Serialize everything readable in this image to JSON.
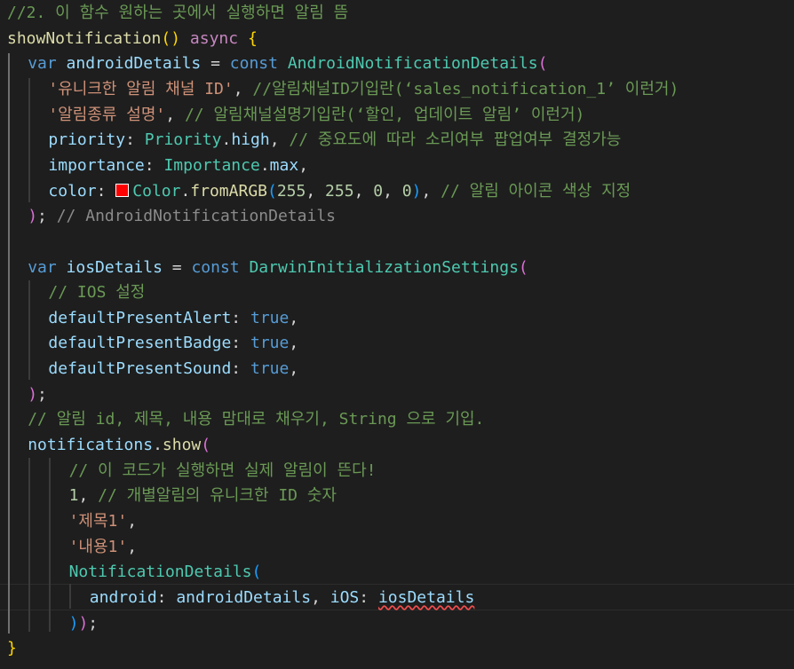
{
  "colors": {
    "background": "#1e1e1e",
    "comment": "#6a9955",
    "keyword": "#569cd6",
    "control": "#c586c0",
    "function": "#dcdcaa",
    "class": "#4ec9b0",
    "variable": "#9cdcfe",
    "string": "#ce9178",
    "number": "#b5cea8",
    "plain": "#d4d4d4",
    "bracket_gold": "#ffd700",
    "bracket_pink": "#da70d6",
    "bracket_blue": "#179fff",
    "color_swatch": "#ff0000",
    "error_squiggle": "#f14c4c"
  },
  "editor": {
    "lines": [
      {
        "indent": 0,
        "tokens": [
          {
            "t": "//2. 이 함수 원하는 곳에서 실행하면 알림 뜸",
            "c": "comment"
          }
        ]
      },
      {
        "indent": 0,
        "tokens": [
          {
            "t": "showNotification",
            "c": "function"
          },
          {
            "t": "() ",
            "c": "bracket_gold"
          },
          {
            "t": "async ",
            "c": "control"
          },
          {
            "t": "{",
            "c": "bracket_gold"
          }
        ]
      },
      {
        "indent": 1,
        "tokens": [
          {
            "t": "var ",
            "c": "keyword"
          },
          {
            "t": "androidDetails",
            "c": "variable"
          },
          {
            "t": " = ",
            "c": "plain"
          },
          {
            "t": "const ",
            "c": "keyword"
          },
          {
            "t": "AndroidNotificationDetails",
            "c": "class"
          },
          {
            "t": "(",
            "c": "bracket_pink"
          }
        ]
      },
      {
        "indent": 2,
        "tokens": [
          {
            "t": "'유니크한 알림 채널 ID'",
            "c": "string"
          },
          {
            "t": ", ",
            "c": "plain"
          },
          {
            "t": "//알림채널ID기입란(‘sales_notification_1’ 이런거)",
            "c": "comment"
          }
        ]
      },
      {
        "indent": 2,
        "tokens": [
          {
            "t": "'알림종류 설명'",
            "c": "string"
          },
          {
            "t": ", ",
            "c": "plain"
          },
          {
            "t": "// 알림채널설명기입란(‘할인, 업데이트 알림’ 이런거)",
            "c": "comment"
          }
        ]
      },
      {
        "indent": 2,
        "tokens": [
          {
            "t": "priority",
            "c": "variable"
          },
          {
            "t": ": ",
            "c": "plain"
          },
          {
            "t": "Priority",
            "c": "class"
          },
          {
            "t": ".",
            "c": "plain"
          },
          {
            "t": "high",
            "c": "variable"
          },
          {
            "t": ", ",
            "c": "plain"
          },
          {
            "t": "// 중요도에 따라 소리여부 팝업여부 결정가능",
            "c": "comment"
          }
        ]
      },
      {
        "indent": 2,
        "tokens": [
          {
            "t": "importance",
            "c": "variable"
          },
          {
            "t": ": ",
            "c": "plain"
          },
          {
            "t": "Importance",
            "c": "class"
          },
          {
            "t": ".",
            "c": "plain"
          },
          {
            "t": "max",
            "c": "variable"
          },
          {
            "t": ",",
            "c": "plain"
          }
        ]
      },
      {
        "indent": 2,
        "tokens": [
          {
            "t": "color",
            "c": "variable"
          },
          {
            "t": ": ",
            "c": "plain"
          },
          {
            "swatch": true
          },
          {
            "t": "Color",
            "c": "class"
          },
          {
            "t": ".",
            "c": "plain"
          },
          {
            "t": "fromARGB",
            "c": "function"
          },
          {
            "t": "(",
            "c": "bracket_blue"
          },
          {
            "t": "255",
            "c": "number"
          },
          {
            "t": ", ",
            "c": "plain"
          },
          {
            "t": "255",
            "c": "number"
          },
          {
            "t": ", ",
            "c": "plain"
          },
          {
            "t": "0",
            "c": "number"
          },
          {
            "t": ", ",
            "c": "plain"
          },
          {
            "t": "0",
            "c": "number"
          },
          {
            "t": ")",
            "c": "bracket_blue"
          },
          {
            "t": ", ",
            "c": "plain"
          },
          {
            "t": "// 알림 아이콘 색상 지정",
            "c": "comment"
          }
        ]
      },
      {
        "indent": 1,
        "tokens": [
          {
            "t": ")",
            "c": "bracket_pink"
          },
          {
            "t": "; ",
            "c": "plain"
          },
          {
            "t": "// AndroidNotificationDetails",
            "c": "comment_dim"
          }
        ]
      },
      {
        "indent": 1,
        "tokens": []
      },
      {
        "indent": 1,
        "tokens": [
          {
            "t": "var ",
            "c": "keyword"
          },
          {
            "t": "iosDetails",
            "c": "variable"
          },
          {
            "t": " = ",
            "c": "plain"
          },
          {
            "t": "const ",
            "c": "keyword"
          },
          {
            "t": "DarwinInitializationSettings",
            "c": "class"
          },
          {
            "t": "(",
            "c": "bracket_pink"
          }
        ]
      },
      {
        "indent": 2,
        "tokens": [
          {
            "t": "// IOS 설정",
            "c": "comment"
          }
        ]
      },
      {
        "indent": 2,
        "tokens": [
          {
            "t": "defaultPresentAlert",
            "c": "variable"
          },
          {
            "t": ": ",
            "c": "plain"
          },
          {
            "t": "true",
            "c": "keyword"
          },
          {
            "t": ",",
            "c": "plain"
          }
        ]
      },
      {
        "indent": 2,
        "tokens": [
          {
            "t": "defaultPresentBadge",
            "c": "variable"
          },
          {
            "t": ": ",
            "c": "plain"
          },
          {
            "t": "true",
            "c": "keyword"
          },
          {
            "t": ",",
            "c": "plain"
          }
        ]
      },
      {
        "indent": 2,
        "tokens": [
          {
            "t": "defaultPresentSound",
            "c": "variable"
          },
          {
            "t": ": ",
            "c": "plain"
          },
          {
            "t": "true",
            "c": "keyword"
          },
          {
            "t": ",",
            "c": "plain"
          }
        ]
      },
      {
        "indent": 1,
        "tokens": [
          {
            "t": ")",
            "c": "bracket_pink"
          },
          {
            "t": ";",
            "c": "plain"
          }
        ]
      },
      {
        "indent": 1,
        "tokens": [
          {
            "t": "// 알림 id, 제목, 내용 맘대로 채우기, String 으로 기입.",
            "c": "comment"
          }
        ]
      },
      {
        "indent": 1,
        "tokens": [
          {
            "t": "notifications",
            "c": "variable"
          },
          {
            "t": ".",
            "c": "plain"
          },
          {
            "t": "show",
            "c": "function"
          },
          {
            "t": "(",
            "c": "bracket_pink"
          }
        ]
      },
      {
        "indent": 3,
        "tokens": [
          {
            "t": "// 이 코드가 실행하면 실제 알림이 뜬다!",
            "c": "comment"
          }
        ]
      },
      {
        "indent": 3,
        "tokens": [
          {
            "t": "1",
            "c": "number"
          },
          {
            "t": ", ",
            "c": "plain"
          },
          {
            "t": "// 개별알림의 유니크한 ID 숫자",
            "c": "comment"
          }
        ]
      },
      {
        "indent": 3,
        "tokens": [
          {
            "t": "'제목1'",
            "c": "string"
          },
          {
            "t": ",",
            "c": "plain"
          }
        ]
      },
      {
        "indent": 3,
        "tokens": [
          {
            "t": "'내용1'",
            "c": "string"
          },
          {
            "t": ",",
            "c": "plain"
          }
        ]
      },
      {
        "indent": 3,
        "tokens": [
          {
            "t": "NotificationDetails",
            "c": "class"
          },
          {
            "t": "(",
            "c": "bracket_blue"
          }
        ]
      },
      {
        "indent": 4,
        "tokens": [
          {
            "t": "android",
            "c": "variable"
          },
          {
            "t": ": ",
            "c": "plain"
          },
          {
            "t": "androidDetails",
            "c": "variable"
          },
          {
            "t": ", ",
            "c": "plain"
          },
          {
            "t": "iOS",
            "c": "variable"
          },
          {
            "t": ": ",
            "c": "plain"
          },
          {
            "t": "iosDetails",
            "c": "variable",
            "squiggle": true
          }
        ]
      },
      {
        "indent": 3,
        "tokens": [
          {
            "t": ")",
            "c": "bracket_blue"
          },
          {
            "t": ")",
            "c": "bracket_pink"
          },
          {
            "t": ";",
            "c": "plain"
          }
        ]
      },
      {
        "indent": 0,
        "tokens": [
          {
            "t": "}",
            "c": "bracket_gold"
          }
        ]
      }
    ]
  }
}
